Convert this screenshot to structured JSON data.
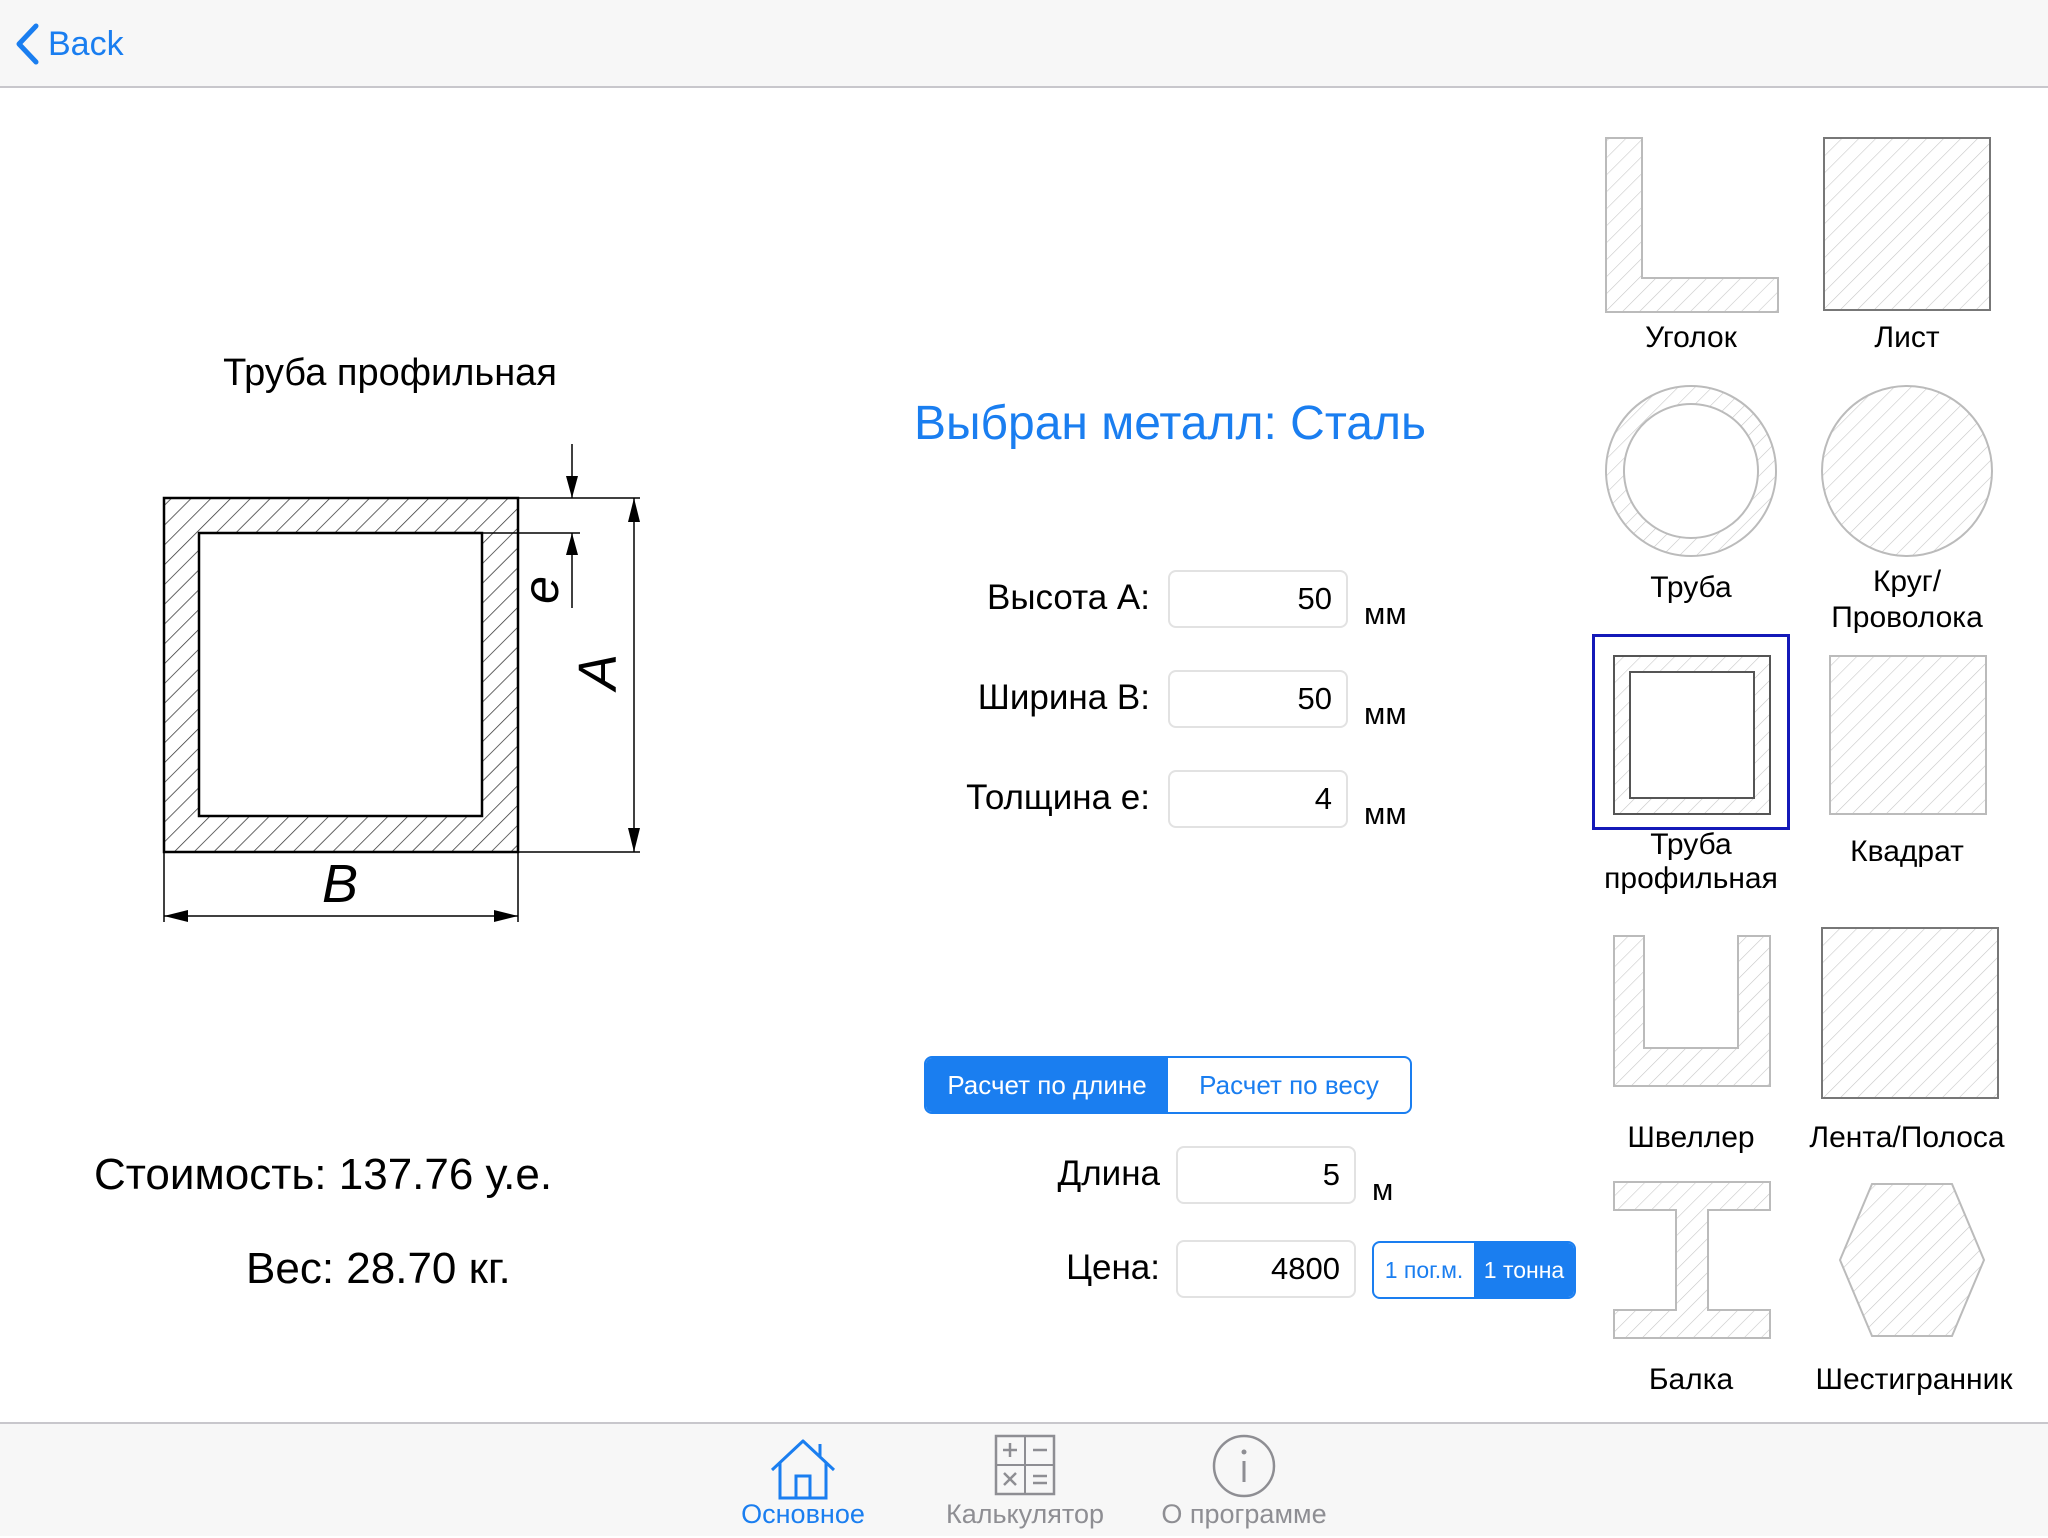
{
  "nav": {
    "back_label": "Back"
  },
  "profile": {
    "title": "Труба профильная",
    "dim_a": "A",
    "dim_b": "B",
    "dim_e": "e"
  },
  "metal": {
    "label": "Выбран металл: Сталь"
  },
  "inputs": {
    "height": {
      "label": "Высота А:",
      "value": "50",
      "unit": "мм"
    },
    "width": {
      "label": "Ширина В:",
      "value": "50",
      "unit": "мм"
    },
    "thickness": {
      "label": "Толщина е:",
      "value": "4",
      "unit": "мм"
    }
  },
  "calc_mode": {
    "options": [
      "Расчет по длине",
      "Расчет по весу"
    ],
    "selected": "Расчет по длине"
  },
  "length": {
    "label": "Длина",
    "value": "5",
    "unit": "м"
  },
  "price": {
    "label": "Цена:",
    "value": "4800",
    "unit_options": [
      "1 пог.м.",
      "1 тонна"
    ],
    "unit_selected": "1 тонна"
  },
  "results": {
    "cost_label": "Стоимость:",
    "cost_value": "137.76 у.е.",
    "weight_label": "Вес:",
    "weight_value": "28.70 кг."
  },
  "shapes": [
    {
      "name": "Уголок",
      "icon": "angle-icon"
    },
    {
      "name": "Лист",
      "icon": "sheet-icon"
    },
    {
      "name": "Труба",
      "icon": "pipe-icon"
    },
    {
      "name": "Круг/\nПроволока",
      "icon": "circle-rod-icon"
    },
    {
      "name": "Труба\nпрофильная",
      "icon": "profile-pipe-icon",
      "selected": true
    },
    {
      "name": "Квадрат",
      "icon": "square-bar-icon"
    },
    {
      "name": "Швеллер",
      "icon": "channel-icon"
    },
    {
      "name": "Лента/Полоса",
      "icon": "strip-icon"
    },
    {
      "name": "Балка",
      "icon": "beam-icon"
    },
    {
      "name": "Шестигранник",
      "icon": "hexagon-icon"
    }
  ],
  "tabs": [
    {
      "label": "Основное",
      "icon": "home-icon",
      "active": true
    },
    {
      "label": "Калькулятор",
      "icon": "calculator-icon",
      "active": false
    },
    {
      "label": "О программе",
      "icon": "info-icon",
      "active": false
    }
  ],
  "colors": {
    "accent": "#1a7ef0",
    "selection": "#1419b8",
    "inactive": "#8e8e93"
  }
}
